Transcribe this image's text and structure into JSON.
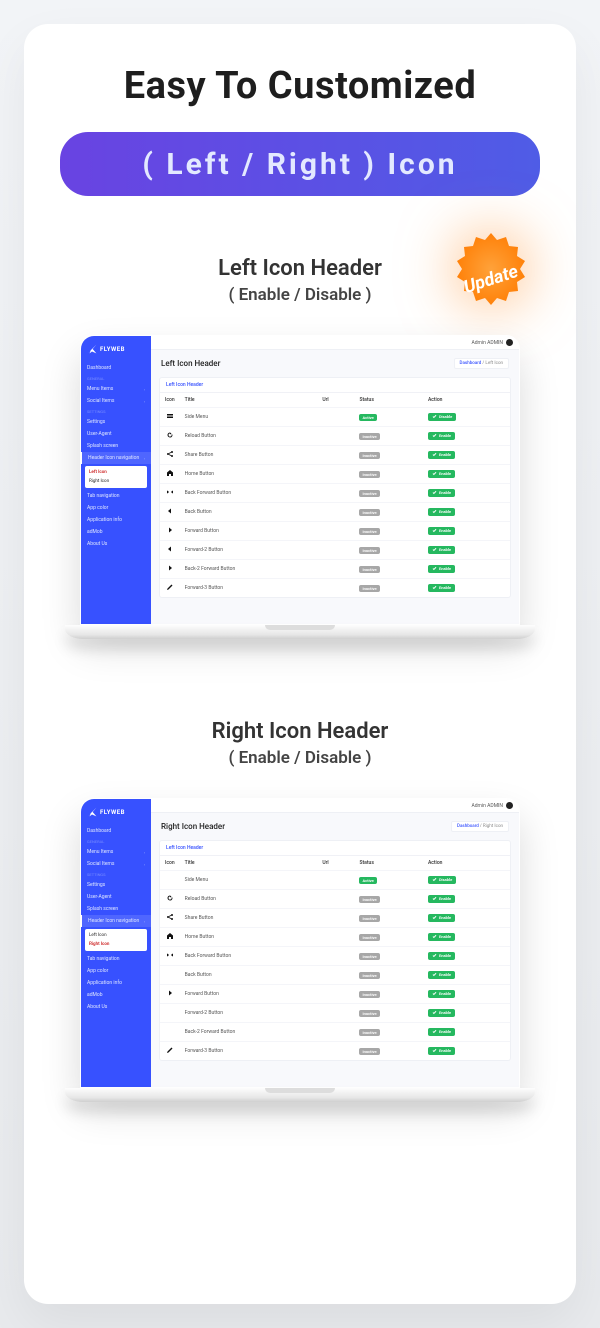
{
  "title1": "Easy To Customized",
  "title_pill": "( Left / Right ) Icon",
  "badge": "Update",
  "sections": [
    {
      "label_a": "Left Icon Header",
      "label_b": "( Enable / Disable )",
      "page_title": "Left Icon Header",
      "crumb_home": "Dashboard",
      "crumb_page": "Left Icon",
      "active_sub": 0
    },
    {
      "label_a": "Right Icon Header",
      "label_b": "( Enable / Disable )",
      "page_title": "Right Icon Header",
      "crumb_home": "Dashboard",
      "crumb_page": "Right Icon",
      "active_sub": 1
    }
  ],
  "admin": {
    "brand": "FLYWEB",
    "user": "Admin ADMIN",
    "sidebar": {
      "groups": [
        {
          "label": "",
          "items": [
            {
              "t": "Dashboard",
              "sub": null
            }
          ]
        },
        {
          "label": "GENERAL",
          "items": [
            {
              "t": "Menu Items",
              "sub": []
            },
            {
              "t": "Social Items",
              "sub": []
            }
          ]
        },
        {
          "label": "SETTINGS",
          "items": [
            {
              "t": "Settings",
              "sub": null
            },
            {
              "t": "User-Agent",
              "sub": null
            },
            {
              "t": "Splash screen",
              "sub": null
            },
            {
              "t": "Header Icon navigation",
              "sub": [
                "Left Icon",
                "Right Icon"
              ],
              "active": true
            },
            {
              "t": "Tab navigation",
              "sub": null
            },
            {
              "t": "App color",
              "sub": null
            },
            {
              "t": "Application info",
              "sub": null
            },
            {
              "t": "adMob",
              "sub": null
            },
            {
              "t": "About Us",
              "sub": null
            }
          ]
        }
      ]
    },
    "panel_title": "Left Icon Header",
    "columns": [
      "Icon",
      "Title",
      "Url",
      "Status",
      "Action"
    ],
    "rows_a": [
      {
        "icon": "menu",
        "title": "Side Menu",
        "status": "Active",
        "btn": "Disable"
      },
      {
        "icon": "reload",
        "title": "Reload Button",
        "status": "Inactive",
        "btn": "Enable"
      },
      {
        "icon": "share",
        "title": "Share Button",
        "status": "Inactive",
        "btn": "Enable"
      },
      {
        "icon": "home",
        "title": "Home Button",
        "status": "Inactive",
        "btn": "Enable"
      },
      {
        "icon": "backfwd",
        "title": "Back Forward Button",
        "status": "Inactive",
        "btn": "Enable"
      },
      {
        "icon": "back",
        "title": "Back Button",
        "status": "Inactive",
        "btn": "Enable"
      },
      {
        "icon": "forward",
        "title": "Forward Button",
        "status": "Inactive",
        "btn": "Enable"
      },
      {
        "icon": "back",
        "title": "Forward-2 Button",
        "status": "Inactive",
        "btn": "Enable"
      },
      {
        "icon": "forward",
        "title": "Back-2 Forward Button",
        "status": "Inactive",
        "btn": "Enable"
      },
      {
        "icon": "pencil",
        "title": "Forward-3 Button",
        "status": "Inactive",
        "btn": "Enable"
      }
    ],
    "rows_b": [
      {
        "icon": "none",
        "title": "Side Menu",
        "status": "Active",
        "btn": "Disable"
      },
      {
        "icon": "reload",
        "title": "Reload Button",
        "status": "Inactive",
        "btn": "Enable"
      },
      {
        "icon": "share",
        "title": "Share Button",
        "status": "Inactive",
        "btn": "Enable"
      },
      {
        "icon": "home",
        "title": "Home Button",
        "status": "Inactive",
        "btn": "Enable"
      },
      {
        "icon": "backfwd",
        "title": "Back Forward Button",
        "status": "Inactive",
        "btn": "Enable"
      },
      {
        "icon": "none",
        "title": "Back Button",
        "status": "Inactive",
        "btn": "Enable"
      },
      {
        "icon": "forward",
        "title": "Forward Button",
        "status": "Inactive",
        "btn": "Enable"
      },
      {
        "icon": "none",
        "title": "Forward-2 Button",
        "status": "Inactive",
        "btn": "Enable"
      },
      {
        "icon": "none",
        "title": "Back-2 Forward Button",
        "status": "Inactive",
        "btn": "Enable"
      },
      {
        "icon": "pencil",
        "title": "Forward-3 Button",
        "status": "Inactive",
        "btn": "Enable"
      }
    ]
  }
}
